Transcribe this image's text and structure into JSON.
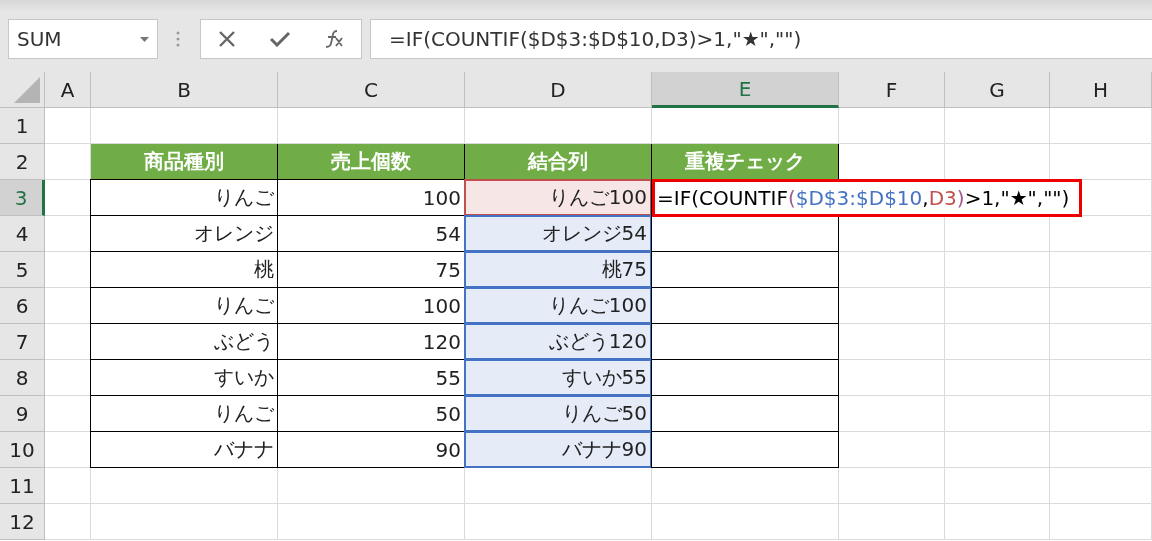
{
  "name_box": {
    "value": "SUM"
  },
  "formula_bar": {
    "value": "=IF(COUNTIF($D$3:$D$10,D3)>1,\"★\",\"\")"
  },
  "columns": [
    {
      "label": "A",
      "selected": false
    },
    {
      "label": "B",
      "selected": false
    },
    {
      "label": "C",
      "selected": false
    },
    {
      "label": "D",
      "selected": false
    },
    {
      "label": "E",
      "selected": true
    },
    {
      "label": "F",
      "selected": false
    },
    {
      "label": "G",
      "selected": false
    },
    {
      "label": "H",
      "selected": false
    }
  ],
  "rows": [
    {
      "label": "1",
      "selected": false
    },
    {
      "label": "2",
      "selected": false,
      "cells": [
        {
          "kind": "header",
          "text": "商品種別"
        },
        {
          "kind": "header",
          "text": "売上個数"
        },
        {
          "kind": "header",
          "text": "結合列"
        },
        {
          "kind": "header",
          "text": "重複チェック"
        }
      ]
    },
    {
      "label": "3",
      "selected": true,
      "cells": [
        {
          "kind": "value",
          "text": "りんご"
        },
        {
          "kind": "value",
          "text": "100"
        },
        {
          "kind": "value",
          "text": "りんご100",
          "color": "#c0504d"
        },
        {
          "kind": "formula",
          "segments": [
            {
              "text": "=IF(COUNTIF",
              "color": "#000000"
            },
            {
              "text": "(",
              "color": "#a05a8c"
            },
            {
              "text": "$D$3:$D$10",
              "color": "#4472c4"
            },
            {
              "text": ",",
              "color": "#000000"
            },
            {
              "text": "D3",
              "color": "#c0504d"
            },
            {
              "text": ")",
              "color": "#a05a8c"
            },
            {
              "text": ">1,\"★\",\"\")",
              "color": "#000000"
            }
          ]
        }
      ]
    },
    {
      "label": "4",
      "selected": false,
      "cells": [
        {
          "kind": "value",
          "text": "オレンジ"
        },
        {
          "kind": "value",
          "text": "54"
        },
        {
          "kind": "value",
          "text": "オレンジ54",
          "color": "#4472c4"
        },
        {
          "kind": "empty"
        }
      ]
    },
    {
      "label": "5",
      "selected": false,
      "cells": [
        {
          "kind": "value",
          "text": "桃"
        },
        {
          "kind": "value",
          "text": "75"
        },
        {
          "kind": "value",
          "text": "桃75",
          "color": "#4472c4"
        },
        {
          "kind": "empty"
        }
      ]
    },
    {
      "label": "6",
      "selected": false,
      "cells": [
        {
          "kind": "value",
          "text": "りんご"
        },
        {
          "kind": "value",
          "text": "100"
        },
        {
          "kind": "value",
          "text": "りんご100",
          "color": "#4472c4"
        },
        {
          "kind": "empty"
        }
      ]
    },
    {
      "label": "7",
      "selected": false,
      "cells": [
        {
          "kind": "value",
          "text": "ぶどう"
        },
        {
          "kind": "value",
          "text": "120"
        },
        {
          "kind": "value",
          "text": "ぶどう120",
          "color": "#4472c4"
        },
        {
          "kind": "empty"
        }
      ]
    },
    {
      "label": "8",
      "selected": false,
      "cells": [
        {
          "kind": "value",
          "text": "すいか"
        },
        {
          "kind": "value",
          "text": "55"
        },
        {
          "kind": "value",
          "text": "すいか55",
          "color": "#4472c4"
        },
        {
          "kind": "empty"
        }
      ]
    },
    {
      "label": "9",
      "selected": false,
      "cells": [
        {
          "kind": "value",
          "text": "りんご"
        },
        {
          "kind": "value",
          "text": "50"
        },
        {
          "kind": "value",
          "text": "りんご50",
          "color": "#4472c4"
        },
        {
          "kind": "empty"
        }
      ]
    },
    {
      "label": "10",
      "selected": false,
      "cells": [
        {
          "kind": "value",
          "text": "バナナ"
        },
        {
          "kind": "value",
          "text": "90"
        },
        {
          "kind": "value",
          "text": "バナナ90",
          "color": "#4472c4"
        },
        {
          "kind": "empty"
        }
      ]
    },
    {
      "label": "11",
      "selected": false
    },
    {
      "label": "12",
      "selected": false
    }
  ]
}
